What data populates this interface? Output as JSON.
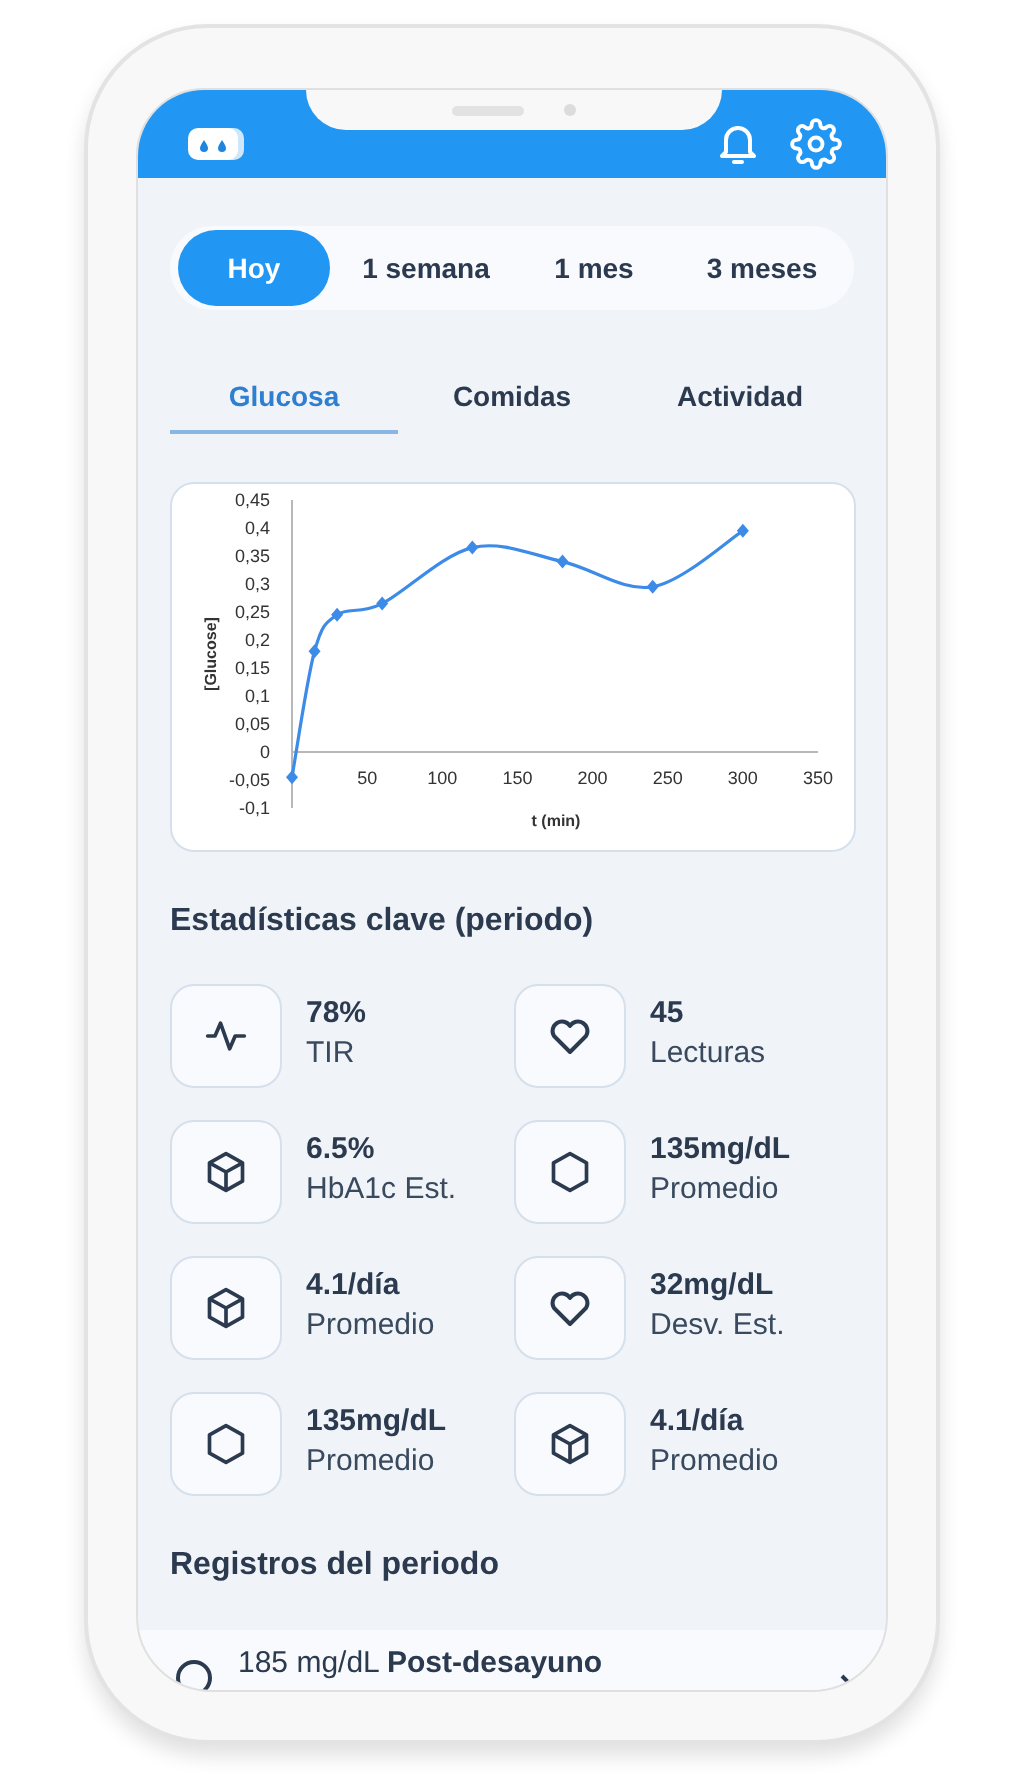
{
  "periods": [
    {
      "label": "Hoy",
      "selected": true
    },
    {
      "label": "1 semana",
      "selected": false
    },
    {
      "label": "1 mes",
      "selected": false
    },
    {
      "label": "3 meses",
      "selected": false
    }
  ],
  "tabs": [
    {
      "label": "Glucosa",
      "selected": true
    },
    {
      "label": "Comidas",
      "selected": false
    },
    {
      "label": "Actividad",
      "selected": false
    }
  ],
  "chart": {
    "chart_data": {
      "type": "line",
      "xlabel": "t (min)",
      "ylabel": "[Glucose]",
      "x": [
        0,
        15,
        30,
        60,
        120,
        180,
        240,
        300
      ],
      "series": [
        {
          "color": "#3d8be8",
          "marker": "diamond",
          "values": [
            -0.045,
            0.18,
            0.245,
            0.265,
            0.365,
            0.34,
            0.295,
            0.395
          ]
        }
      ],
      "xlim": [
        0,
        350
      ],
      "ylim": [
        -0.1,
        0.45
      ],
      "xticks": [
        50,
        100,
        150,
        200,
        250,
        300,
        350
      ],
      "yticks": [
        {
          "value": -0.1,
          "label": "-0,1"
        },
        {
          "value": -0.05,
          "label": "-0,05"
        },
        {
          "value": 0,
          "label": "0"
        },
        {
          "value": 0.05,
          "label": "0,05"
        },
        {
          "value": 0.1,
          "label": "0,1"
        },
        {
          "value": 0.15,
          "label": "0,15"
        },
        {
          "value": 0.2,
          "label": "0,2"
        },
        {
          "value": 0.25,
          "label": "0,25"
        },
        {
          "value": 0.3,
          "label": "0,3"
        },
        {
          "value": 0.35,
          "label": "0,35"
        },
        {
          "value": 0.4,
          "label": "0,4"
        },
        {
          "value": 0.45,
          "label": "0,45"
        }
      ]
    }
  },
  "stats_title": "Estadísticas clave (periodo)",
  "stats": [
    {
      "kind": "pulse",
      "value": "78%",
      "label": "TIR"
    },
    {
      "kind": "heart",
      "value": "45",
      "label": "Lecturas"
    },
    {
      "kind": "cube",
      "value": "6.5%",
      "label": "HbA1c Est."
    },
    {
      "kind": "hexagon",
      "value": "135mg/dL",
      "label": "Promedio"
    },
    {
      "kind": "cube",
      "value": "4.1/día",
      "label": "Promedio"
    },
    {
      "kind": "heart",
      "value": "32mg/dL",
      "label": "Desv. Est."
    },
    {
      "kind": "hexagon",
      "value": "135mg/dL",
      "label": "Promedio"
    },
    {
      "kind": "cube",
      "value": "4.1/día",
      "label": "Promedio"
    }
  ],
  "records_title": "Registros del periodo",
  "records": [
    {
      "text": "185 mg/dL **Post-desayuno**"
    }
  ]
}
